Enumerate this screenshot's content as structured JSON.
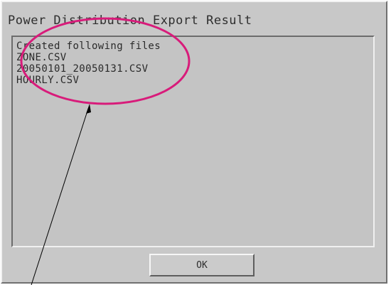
{
  "dialog": {
    "title": "Power Distribution Export Result",
    "message_lines": [
      "Created following files",
      "ZONE.CSV",
      "20050101_20050131.CSV",
      "HOURLY.CSV"
    ],
    "ok_label": "OK"
  },
  "annotation": {
    "highlight_color": "#d81b7a",
    "pointer_color": "#000000"
  }
}
